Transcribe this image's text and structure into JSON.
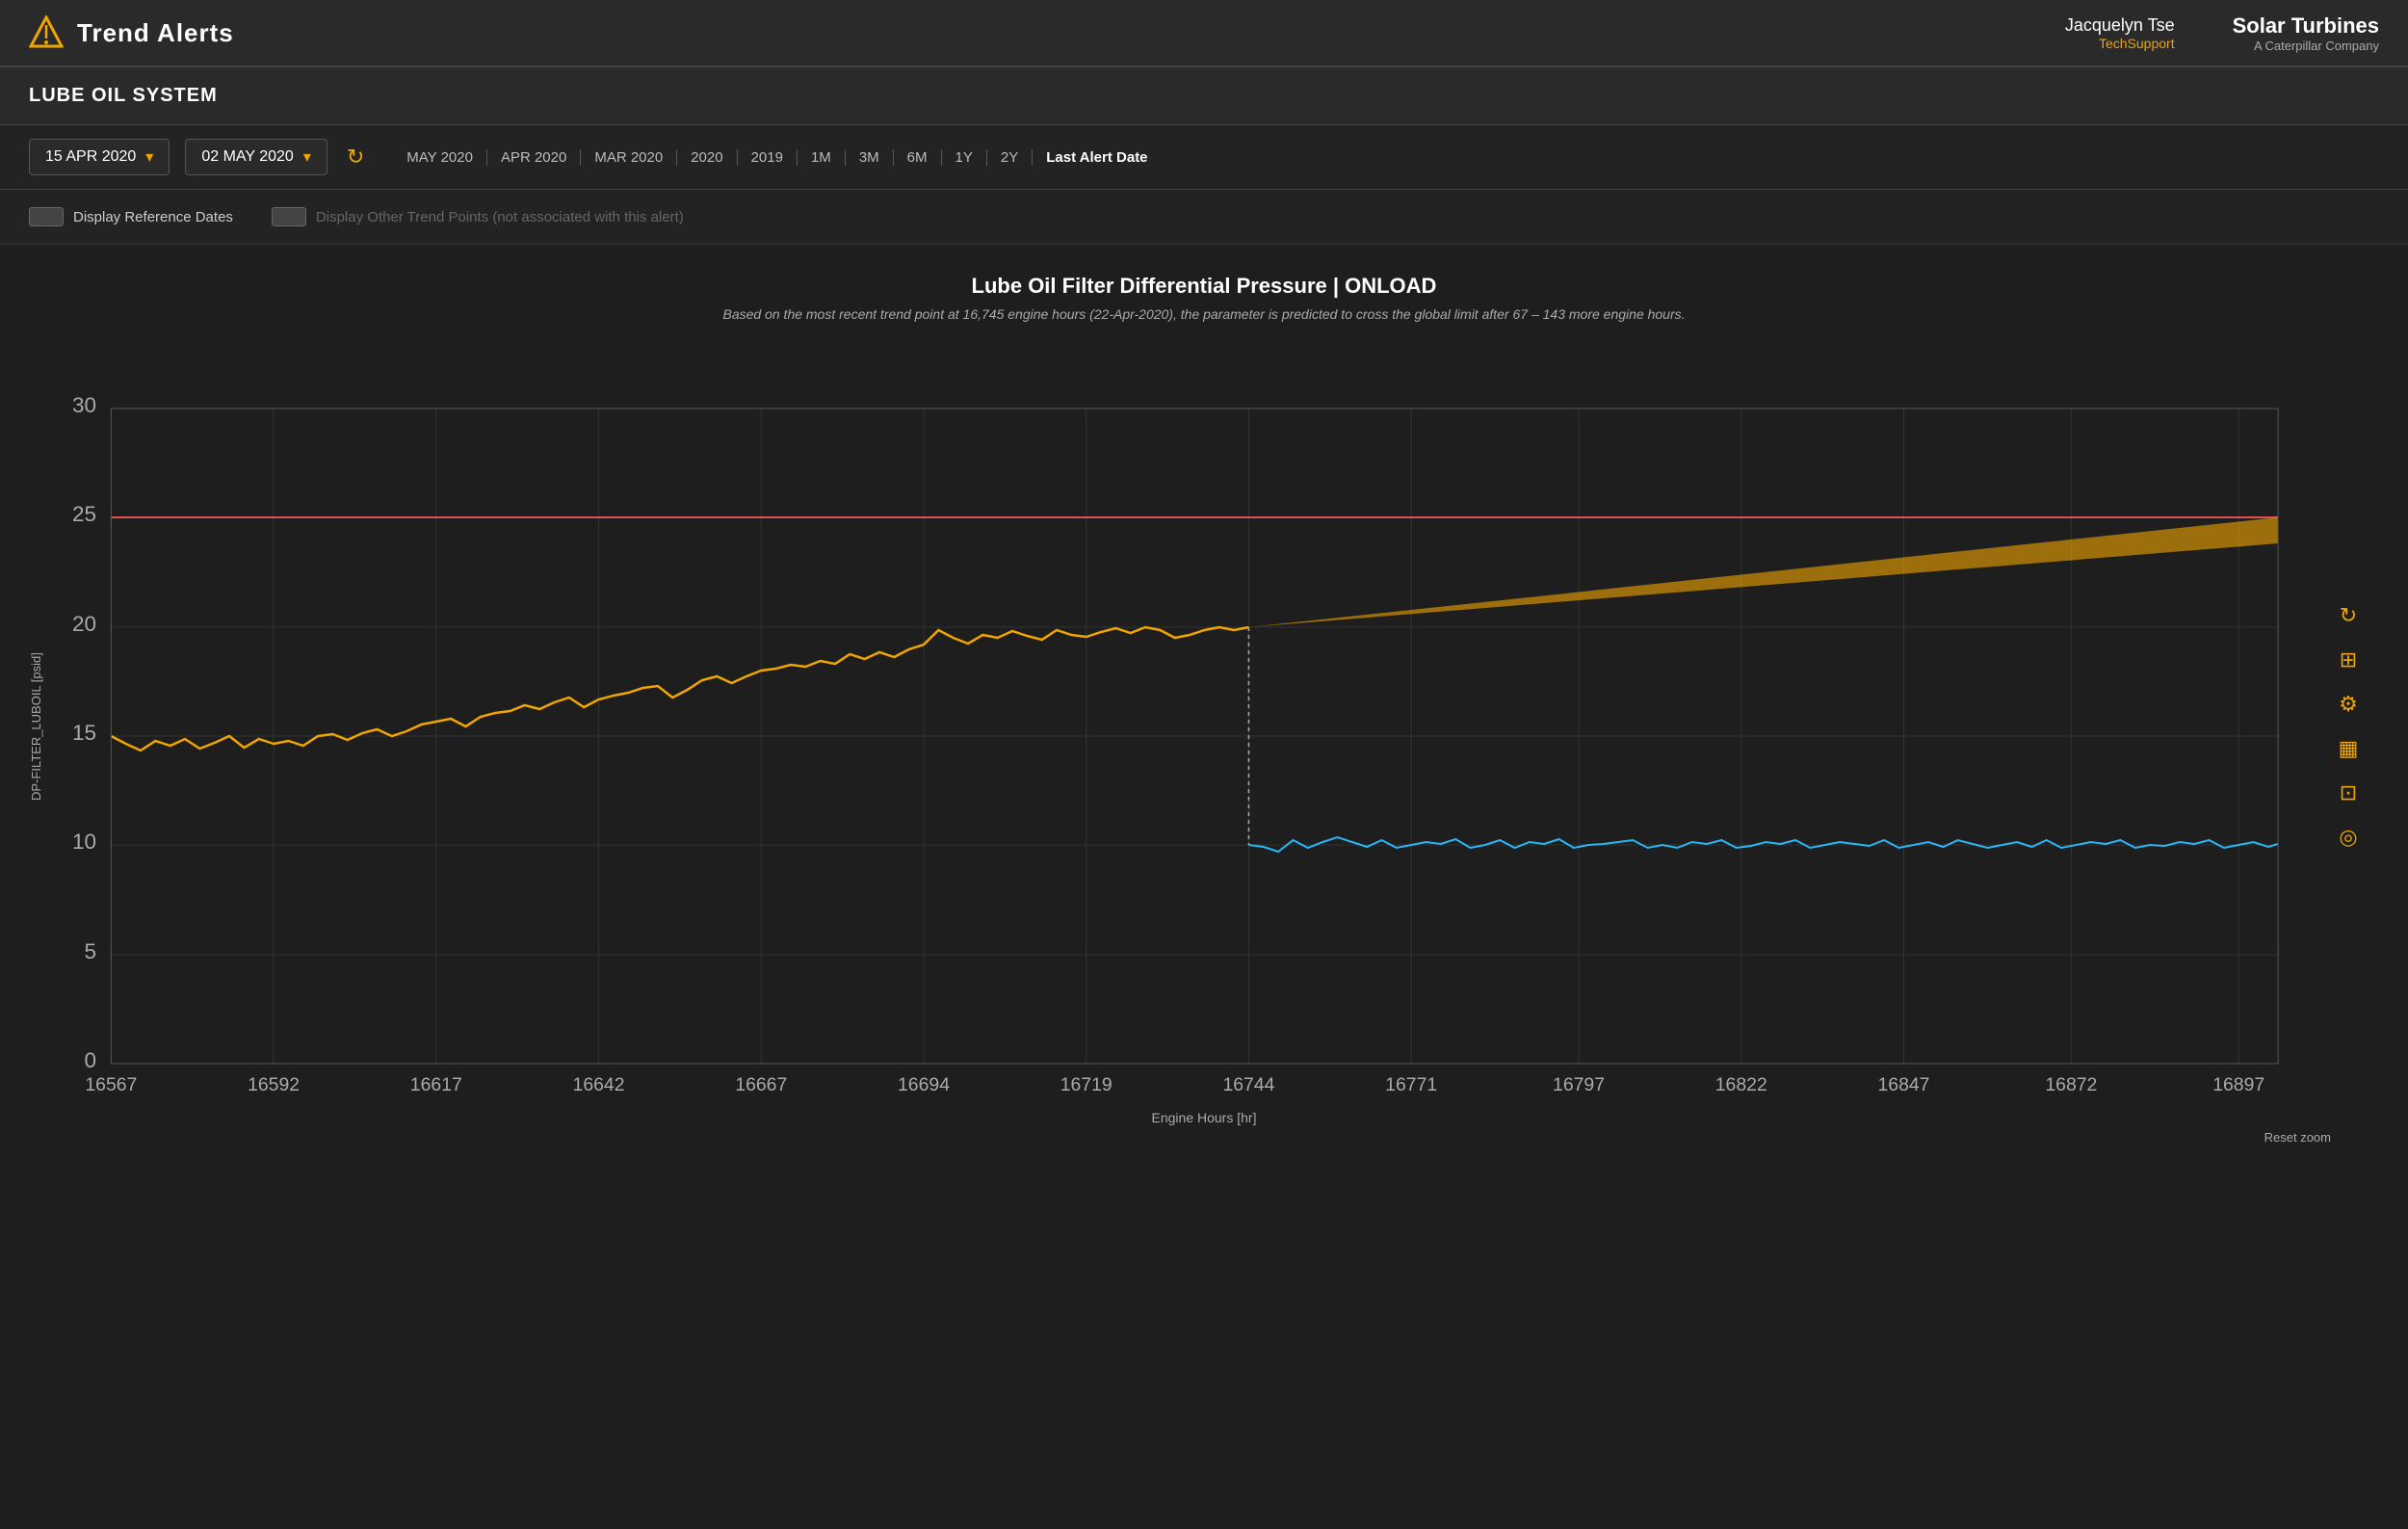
{
  "header": {
    "app_name": "Trend Alerts",
    "user_name": "Jacquelyn Tse",
    "user_role": "TechSupport",
    "brand_name": "Solar Turbines",
    "brand_sub": "A Caterpillar Company"
  },
  "page": {
    "system_title": "LUBE OIL SYSTEM"
  },
  "controls": {
    "start_date": "15 APR 2020",
    "end_date": "02 MAY 2020",
    "refresh_label": "refresh",
    "nav_items": [
      "MAY 2020",
      "APR 2020",
      "MAR 2020",
      "2020",
      "2019",
      "1M",
      "3M",
      "6M",
      "1Y",
      "2Y",
      "Last Alert Date"
    ]
  },
  "options": {
    "display_reference_dates_label": "Display Reference Dates",
    "display_other_trend_label": "Display Other Trend Points (not associated with this alert)"
  },
  "chart": {
    "title": "Lube Oil Filter Differential Pressure | ONLOAD",
    "subtitle": "Based on the most recent trend point at 16,745 engine hours (22-Apr-2020), the parameter is predicted to cross the global limit after 67 – 143 more engine hours.",
    "y_axis_label": "DP-FILTER_LUBOIL [psid]",
    "x_axis_label": "Engine Hours [hr]",
    "y_ticks": [
      "0",
      "5",
      "10",
      "15",
      "20",
      "25",
      "30"
    ],
    "x_ticks": [
      "16567",
      "16592",
      "16617",
      "16642",
      "16667",
      "16694",
      "16719",
      "16744",
      "16771",
      "16797",
      "16822",
      "16847",
      "16872",
      "16897"
    ],
    "global_limit": 25,
    "reset_zoom_label": "Reset zoom",
    "colors": {
      "orange_line": "#f0a500",
      "blue_line": "#29b6f6",
      "red_limit": "#e05050",
      "prediction_band": "#f0a500",
      "grid": "#333"
    }
  },
  "icons": {
    "refresh": "↻",
    "chart_refresh": "↻",
    "chart_table": "⊞",
    "chart_settings": "⚙",
    "chart_bar": "▦",
    "chart_image": "⊡",
    "chart_target": "◎"
  }
}
